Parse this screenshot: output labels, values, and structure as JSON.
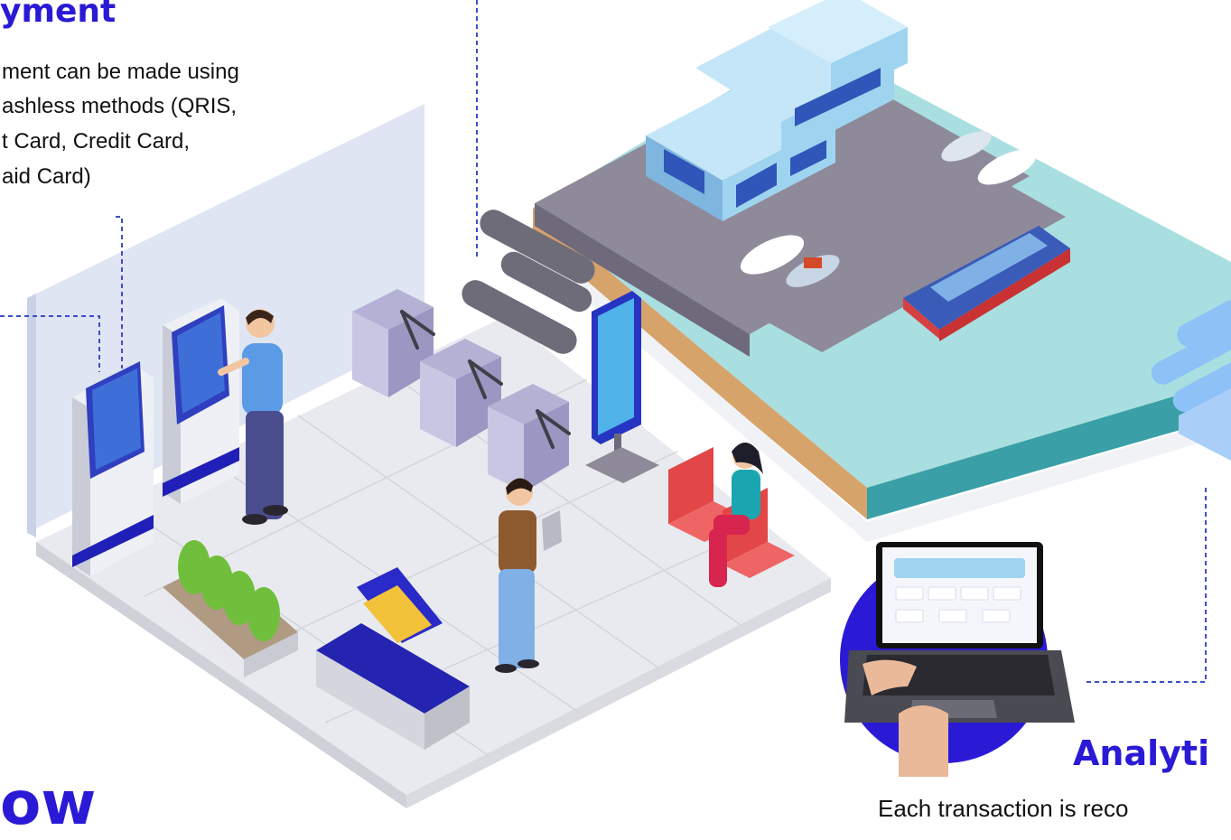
{
  "payment": {
    "heading": "yment",
    "lines": [
      "ment can be made using",
      "ashless methods (QRIS,",
      "t Card, Credit Card,",
      "aid Card)"
    ]
  },
  "analytics": {
    "heading": "Analyti",
    "description": "Each transaction is reco"
  },
  "flow": {
    "heading": "ow"
  },
  "colors": {
    "accent": "#2a1ad6",
    "dashed_line": "#3b4fc8",
    "water": "#8fd6d2",
    "pier": "#8e8a99",
    "building": "#9fd4f0"
  },
  "icons": [
    "ticket-kiosk",
    "turnstile-gate",
    "digital-signage",
    "laptop-dashboard"
  ]
}
